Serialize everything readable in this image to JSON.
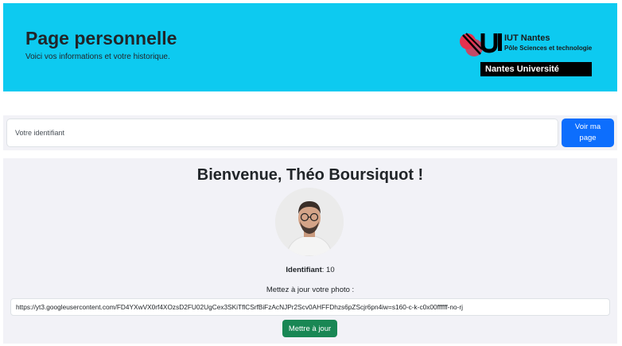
{
  "header": {
    "title": "Page personnelle",
    "subtitle": "Voici vos informations et votre historique.",
    "logo": {
      "title": "IUT Nantes",
      "subtitle": "Pôle Sciences et technologie",
      "band": "Nantes Université"
    }
  },
  "search": {
    "placeholder": "Votre identifiant",
    "button_label": "Voir ma page"
  },
  "profile": {
    "welcome": "Bienvenue, Théo Boursiquot !",
    "id_label": "Identifiant",
    "id_value": ": 10",
    "photo_prompt": "Mettez à jour votre photo :",
    "photo_url": "https://yt3.googleusercontent.com/FD4YXwVX0rf4XOzsD2FU02UgCex3SKiTflCSrfBiFzAcNJPr2Scv0AHFFDhzs6pZScjr6pn4iw=s160-c-k-c0x00ffffff-no-rj",
    "update_button": "Mettre à jour"
  },
  "colors": {
    "header_bg": "#0dcaf0",
    "primary": "#0d6efd",
    "success": "#198754",
    "card_bg": "#f2f2f7"
  }
}
